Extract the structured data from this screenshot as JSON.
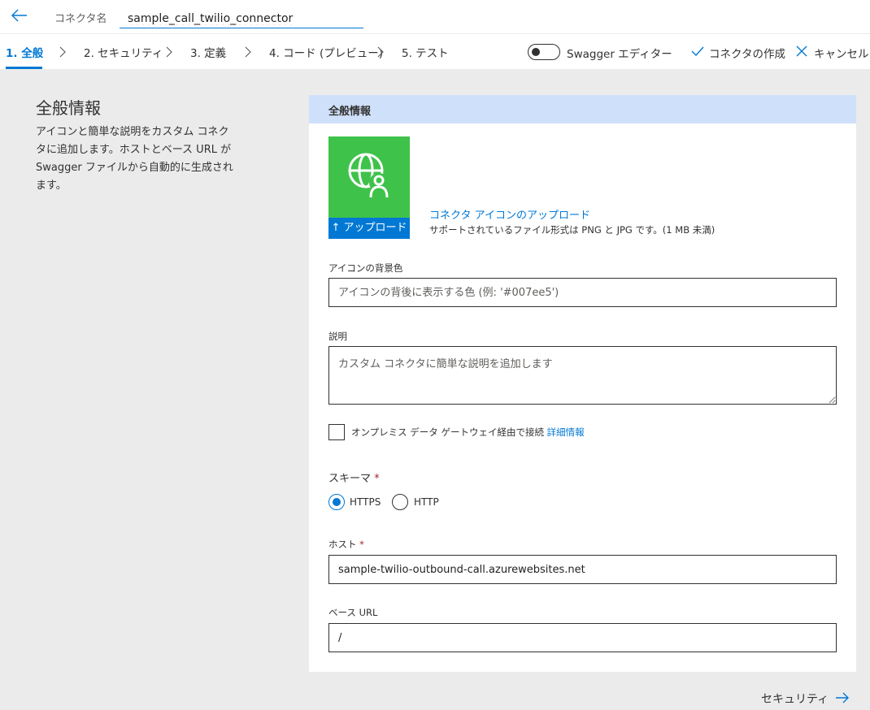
{
  "header": {
    "connector_name_label": "コネクタ名",
    "connector_name_value": "sample_call_twilio_connector"
  },
  "steps": [
    {
      "label": "1. 全般",
      "active": true
    },
    {
      "label": "2. セキュリティ",
      "active": false
    },
    {
      "label": "3. 定義",
      "active": false
    },
    {
      "label": "4. コード (プレビュー)",
      "active": false
    },
    {
      "label": "5. テスト",
      "active": false
    }
  ],
  "toolbar": {
    "swagger_editor_label": "Swagger エディター",
    "swagger_editor_on": false,
    "create_connector_label": "コネクタの作成",
    "cancel_label": "キャンセル"
  },
  "side": {
    "title": "全般情報",
    "description": "アイコンと簡単な説明をカスタム コネクタに追加します。ホストとベース URL が Swagger ファイルから自動的に生成されます。"
  },
  "panel": {
    "header": "全般情報",
    "icon_color": "#3fc24a",
    "upload_button": "アップロード",
    "upload_link": "コネクタ アイコンのアップロード",
    "upload_hint": "サポートされているファイル形式は PNG と JPG です。(1 MB 未満)",
    "icon_bg_label": "アイコンの背景色",
    "icon_bg_placeholder": "アイコンの背後に表示する色 (例: '#007ee5')",
    "description_label": "説明",
    "description_placeholder": "カスタム コネクタに簡単な説明を追加します",
    "gateway_label": "オンプレミス データ ゲートウェイ経由で接続",
    "gateway_link": "詳細情報",
    "gateway_checked": false,
    "schema_label": "スキーマ",
    "required_mark": "*",
    "schema_options": [
      "HTTPS",
      "HTTP"
    ],
    "schema_selected": "HTTPS",
    "host_label": "ホスト",
    "host_value": "sample-twilio-outbound-call.azurewebsites.net",
    "base_url_label": "ベース URL",
    "base_url_value": "/"
  },
  "footer": {
    "next_label": "セキュリティ"
  },
  "colors": {
    "accent": "#0078d4",
    "panel_header_bg": "#cfe0fb",
    "page_bg": "#ebebeb"
  }
}
